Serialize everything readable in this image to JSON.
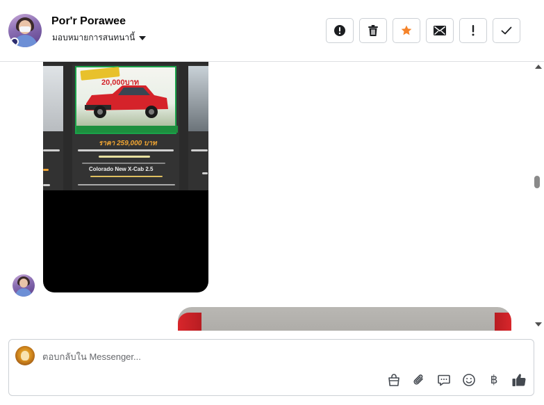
{
  "header": {
    "contact_name": "Por'r Porawee",
    "assign_label": "มอบหมายการสนทนานี้",
    "actions": [
      {
        "name": "spam-button",
        "icon": "alert-circle-icon"
      },
      {
        "name": "delete-button",
        "icon": "trash-icon"
      },
      {
        "name": "star-button",
        "icon": "star-icon",
        "color": "#f5832a"
      },
      {
        "name": "mark-unread-button",
        "icon": "envelope-icon"
      },
      {
        "name": "follow-up-button",
        "icon": "exclamation-icon"
      },
      {
        "name": "mark-done-button",
        "icon": "checkmark-icon"
      }
    ]
  },
  "conversation": {
    "shared_listing": {
      "price_text": "ราคา 259,000 บาท",
      "model_text": "Colorado New X-Cab 2.5",
      "promo_text": "20,000บาท",
      "price_color": "#f0a533"
    }
  },
  "composer": {
    "placeholder": "ตอบกลับใน Messenger...",
    "tools": [
      {
        "name": "shop-button",
        "icon": "shopping-bag-icon"
      },
      {
        "name": "attach-button",
        "icon": "paperclip-icon"
      },
      {
        "name": "saved-replies-button",
        "icon": "chat-bubble-icon"
      },
      {
        "name": "emoji-button",
        "icon": "smiley-icon"
      },
      {
        "name": "payment-button",
        "icon": "baht-icon",
        "glyph": "฿"
      },
      {
        "name": "like-button",
        "icon": "thumbs-up-icon"
      }
    ]
  },
  "colors": {
    "border": "#ccd0d5",
    "star": "#f5832a",
    "icon": "#444950"
  }
}
